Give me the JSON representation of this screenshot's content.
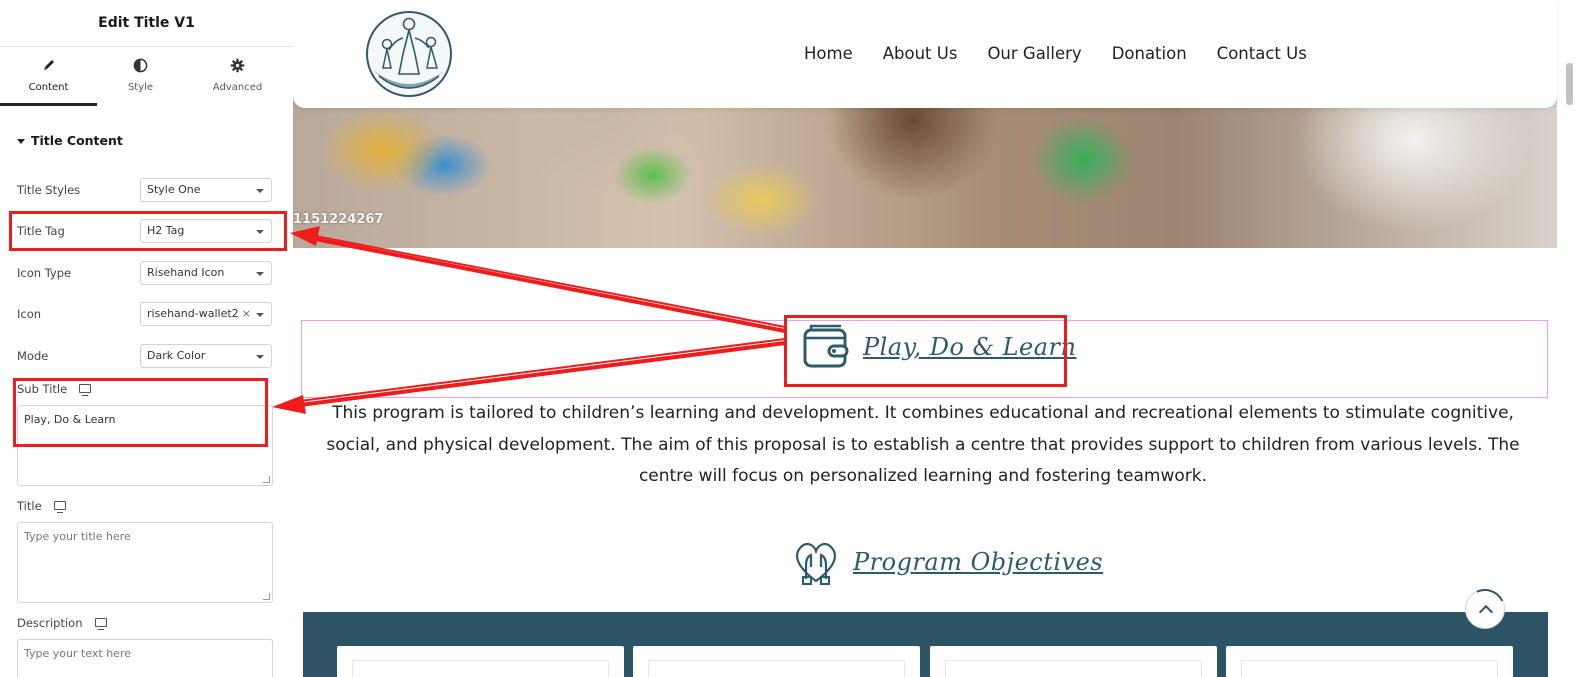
{
  "panel": {
    "title": "Edit Title V1",
    "tabs": [
      {
        "label": "Content",
        "icon": "pencil-icon"
      },
      {
        "label": "Style",
        "icon": "contrast-icon"
      },
      {
        "label": "Advanced",
        "icon": "gear-icon"
      }
    ],
    "section_title": "Title Content",
    "controls": {
      "title_styles": {
        "label": "Title Styles",
        "value": "Style One"
      },
      "title_tag": {
        "label": "Title Tag",
        "value": "H2 Tag"
      },
      "icon_type": {
        "label": "Icon Type",
        "value": "Risehand Icon"
      },
      "icon": {
        "label": "Icon",
        "value": "risehand-wallet2",
        "clear": "×"
      },
      "mode": {
        "label": "Mode",
        "value": "Dark Color"
      },
      "sub_title": {
        "label": "Sub Title",
        "value": "Play, Do & Learn"
      },
      "title": {
        "label": "Title",
        "placeholder": "Type your title here"
      },
      "description": {
        "label": "Description",
        "placeholder": "Type your text here"
      }
    },
    "collapse_icon": "‹"
  },
  "site": {
    "nav": [
      "Home",
      "About Us",
      "Our Gallery",
      "Donation",
      "Contact Us"
    ],
    "hero_label": "1151224267",
    "subtitle_heading": "Play, Do & Learn",
    "description": "This program is tailored to children’s learning and development. It combines educational and recreational elements to stimulate cognitive, social, and physical development. The aim of this proposal is to establish a centre that provides support to children from various levels. The centre will focus on personalized learning and fostering teamwork.",
    "objectives_heading": "Program Objectives"
  },
  "colors": {
    "accent": "#2e5a6b",
    "annotation_red": "#ef1c1c",
    "widget_outline": "#e6a0ee",
    "cards_background": "#2d5464"
  },
  "icons": {
    "heading_icon_1": "wallet-icon",
    "heading_icon_2": "heart-hands-icon",
    "scroll_top": "arrow-up-icon"
  }
}
